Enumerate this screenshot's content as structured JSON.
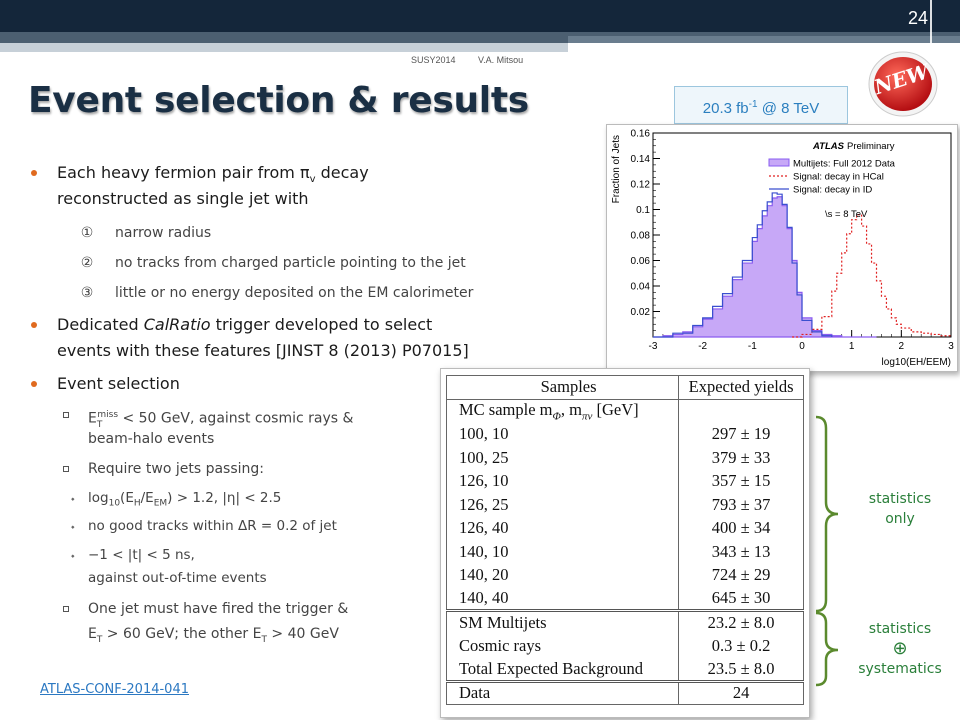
{
  "header": {
    "page_number": "24",
    "conference": "SUSY2014",
    "author": "V.A. Mitsou"
  },
  "title": "Event selection & results",
  "luminosity_badge": {
    "value": "20.3 fb",
    "exponent": "-1",
    "suffix": " @ 8 TeV"
  },
  "new_badge": "NEW",
  "bullets": {
    "b1_line1_pre": "Each heavy fermion pair from π",
    "b1_line1_sub": "v",
    "b1_line1_post": " decay",
    "b1_line2": "reconstructed as single jet with",
    "b1_items": [
      {
        "marker": "①",
        "text": "narrow radius"
      },
      {
        "marker": "②",
        "text": "no tracks from charged particle pointing to the jet"
      },
      {
        "marker": "③",
        "text": "little or no energy deposited on the EM calorimeter"
      }
    ],
    "b2_line1_pre": "Dedicated ",
    "b2_line1_em": "CalRatio",
    "b2_line1_post": " trigger developed to select",
    "b2_line2": "events with these features [JINST 8 (2013) P07015]",
    "b3": "Event selection",
    "sel1_pre": "E",
    "sel1_sub": "T",
    "sel1_sup": "miss",
    "sel1_post": " < 50 GeV, against cosmic rays &",
    "sel1_line2": "beam-halo events",
    "sel2": "Require two jets passing:",
    "cut1_pre": "log",
    "cut1_sub1": "10",
    "cut1_mid1": "(E",
    "cut1_sub2": "H",
    "cut1_mid2": "/E",
    "cut1_sub3": "EM",
    "cut1_post": ") > 1.2, |η| < 2.5",
    "cut2": "no good tracks within ΔR = 0.2 of jet",
    "cut3_line1": "−1 < |t| < 5 ns,",
    "cut3_line2": "against out-of-time events",
    "sel3_line1": "One jet must have fired the trigger &",
    "sel3_line2_a": "E",
    "sel3_line2_sub_a": "T",
    "sel3_line2_b": " > 60 GeV; the other E",
    "sel3_line2_sub_b": "T",
    "sel3_line2_c": " > 40 GeV"
  },
  "reference": "ATLAS-CONF-2014-041",
  "chart_data": {
    "type": "line",
    "xlabel": "log10(EH/EEM)",
    "ylabel": "Fraction of Jets",
    "xlim": [
      -3,
      3
    ],
    "ylim": [
      0,
      0.16
    ],
    "x_ticks": [
      "-3",
      "-2",
      "-1",
      "0",
      "1",
      "2",
      "3"
    ],
    "y_ticks": [
      "0.02",
      "0.04",
      "0.06",
      "0.08",
      "0.1",
      "0.12",
      "0.14",
      "0.16"
    ],
    "annotation_title": "ATLAS",
    "annotation_sub": " Preliminary",
    "energy_label": "\\s = 8 TeV",
    "legend_position": "top-right",
    "series": [
      {
        "name": "Multijets: Full 2012 Data",
        "color": "#8a5cf0",
        "x": [
          -3.0,
          -2.8,
          -2.6,
          -2.4,
          -2.2,
          -2.0,
          -1.8,
          -1.6,
          -1.4,
          -1.2,
          -1.0,
          -0.9,
          -0.8,
          -0.7,
          -0.6,
          -0.5,
          -0.4,
          -0.3,
          -0.2,
          -0.1,
          0.0,
          0.2,
          0.4,
          0.6,
          0.8,
          1.0,
          1.2,
          1.5
        ],
        "values": [
          0.0,
          0.001,
          0.002,
          0.004,
          0.008,
          0.014,
          0.022,
          0.032,
          0.045,
          0.058,
          0.075,
          0.085,
          0.095,
          0.103,
          0.109,
          0.11,
          0.103,
          0.085,
          0.06,
          0.035,
          0.015,
          0.005,
          0.002,
          0.001,
          0.0,
          0.0,
          0.0,
          0.0
        ]
      },
      {
        "name": "Signal: decay in HCal",
        "color": "#e02020",
        "x": [
          -0.2,
          0.0,
          0.2,
          0.4,
          0.6,
          0.7,
          0.8,
          0.9,
          1.0,
          1.1,
          1.2,
          1.3,
          1.4,
          1.5,
          1.6,
          1.7,
          1.8,
          1.9,
          2.0,
          2.2,
          2.4,
          2.6,
          2.8,
          3.0
        ],
        "values": [
          0.0,
          0.002,
          0.006,
          0.016,
          0.036,
          0.05,
          0.066,
          0.081,
          0.092,
          0.096,
          0.087,
          0.073,
          0.058,
          0.044,
          0.032,
          0.022,
          0.015,
          0.01,
          0.007,
          0.004,
          0.003,
          0.002,
          0.001,
          0.0
        ]
      },
      {
        "name": "Signal: decay in ID",
        "color": "#3a4fcf",
        "x": [
          -3.0,
          -2.6,
          -2.2,
          -2.0,
          -1.8,
          -1.6,
          -1.4,
          -1.2,
          -1.0,
          -0.9,
          -0.8,
          -0.7,
          -0.6,
          -0.5,
          -0.4,
          -0.3,
          -0.2,
          -0.1,
          0.0,
          0.2,
          0.4,
          0.6
        ],
        "values": [
          0.0,
          0.003,
          0.009,
          0.015,
          0.024,
          0.034,
          0.047,
          0.06,
          0.078,
          0.088,
          0.099,
          0.106,
          0.113,
          0.112,
          0.104,
          0.086,
          0.058,
          0.033,
          0.013,
          0.004,
          0.001,
          0.0
        ]
      }
    ]
  },
  "table": {
    "headers": [
      "Samples",
      "Expected yields"
    ],
    "mc_header": "MC sample m",
    "mc_header_sub1": "Φ",
    "mc_header_mid": ", m",
    "mc_header_sub2": "πv",
    "mc_header_unit": " [GeV]",
    "mc_rows": [
      [
        "100, 10",
        "297 ± 19"
      ],
      [
        "100, 25",
        "379 ± 33"
      ],
      [
        "126, 10",
        "357 ± 15"
      ],
      [
        "126, 25",
        "793 ± 37"
      ],
      [
        "126, 40",
        "400 ± 34"
      ],
      [
        "140, 10",
        "343 ± 13"
      ],
      [
        "140, 20",
        "724 ± 29"
      ],
      [
        "140, 40",
        "645 ± 30"
      ]
    ],
    "bkg_rows": [
      [
        "SM Multijets",
        "23.2 ± 8.0"
      ],
      [
        "Cosmic rays",
        "0.3 ± 0.2"
      ],
      [
        "Total Expected Background",
        "23.5 ± 8.0"
      ]
    ],
    "data_row": [
      "Data",
      "24"
    ]
  },
  "annotations": {
    "stat_only_line1": "statistics",
    "stat_only_line2": "only",
    "stat_syst_line1": "statistics",
    "stat_syst_symbol": "⊕",
    "stat_syst_line2": "systematics"
  }
}
